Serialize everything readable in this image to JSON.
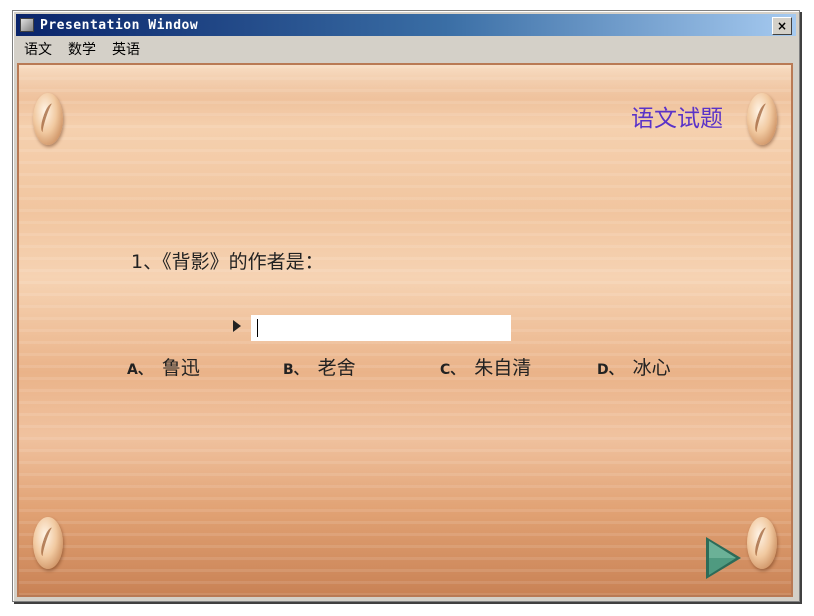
{
  "window": {
    "title": "Presentation Window",
    "close_glyph": "×"
  },
  "menu": {
    "items": [
      "语文",
      "数学",
      "英语"
    ]
  },
  "stage": {
    "title": "语文试题",
    "question": "1、《背影》的作者是：",
    "answer": {
      "value": "",
      "placeholder": ""
    },
    "options": [
      {
        "letter": "A、",
        "text": "鲁迅"
      },
      {
        "letter": "B、",
        "text": "老舍"
      },
      {
        "letter": "C、",
        "text": "朱自清"
      },
      {
        "letter": "D、",
        "text": "冰心"
      }
    ],
    "next_icon": "play-arrow-icon"
  },
  "colors": {
    "title_accent": "#5a33c8",
    "next_arrow": "#3f8a72"
  }
}
